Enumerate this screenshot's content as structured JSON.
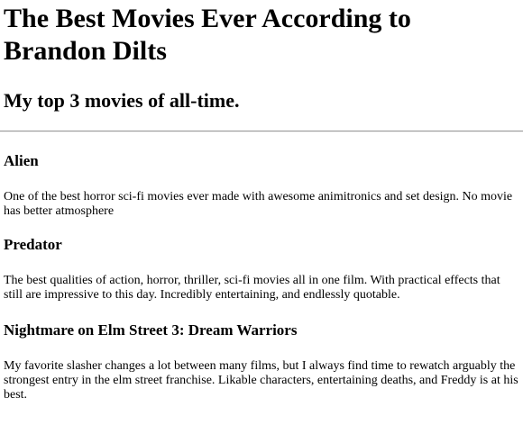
{
  "page": {
    "title": "The Best Movies Ever According to Brandon Dilts",
    "subtitle": "My top 3 movies of all-time."
  },
  "movies": [
    {
      "title": "Alien",
      "description": "One of the best horror sci-fi movies ever made with awesome animitronics and set design. No movie has better atmosphere"
    },
    {
      "title": "Predator",
      "description": "The best qualities of action, horror, thriller, sci-fi movies all in one film. With practical effects that still are impressive to this day. Incredibly entertaining, and endlessly quotable."
    },
    {
      "title": "Nightmare on Elm Street 3: Dream Warriors",
      "description": "My favorite slasher changes a lot between many films, but I always find time to rewatch arguably the strongest entry in the elm street franchise. Likable characters, entertaining deaths, and Freddy is at his best."
    }
  ]
}
